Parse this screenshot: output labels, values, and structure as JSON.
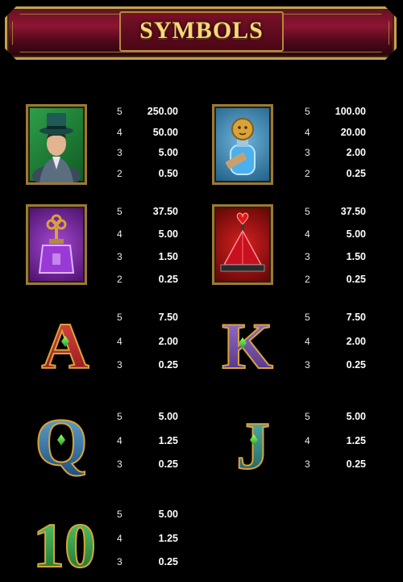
{
  "header": {
    "title": "SYMBOLS"
  },
  "colors": {
    "banner_red": "#8d1532",
    "gold": "#c9a050",
    "title_gold": "#f7d77a",
    "background": "#000000"
  },
  "symbols": [
    {
      "name": "magician",
      "icon": "magician-top-hat-icon",
      "payouts": [
        {
          "count": "5",
          "value": "250.00"
        },
        {
          "count": "4",
          "value": "50.00"
        },
        {
          "count": "3",
          "value": "5.00"
        },
        {
          "count": "2",
          "value": "0.50"
        }
      ]
    },
    {
      "name": "courage-potion",
      "icon": "courage-lion-bottle-icon",
      "payouts": [
        {
          "count": "5",
          "value": "100.00"
        },
        {
          "count": "4",
          "value": "20.00"
        },
        {
          "count": "3",
          "value": "2.00"
        },
        {
          "count": "2",
          "value": "0.25"
        }
      ]
    },
    {
      "name": "purple-perfume",
      "icon": "perfume-bottle-icon",
      "payouts": [
        {
          "count": "5",
          "value": "37.50"
        },
        {
          "count": "4",
          "value": "5.00"
        },
        {
          "count": "3",
          "value": "1.50"
        },
        {
          "count": "2",
          "value": "0.25"
        }
      ]
    },
    {
      "name": "ruby-heart-pyramid",
      "icon": "ruby-pyramid-icon",
      "payouts": [
        {
          "count": "5",
          "value": "37.50"
        },
        {
          "count": "4",
          "value": "5.00"
        },
        {
          "count": "3",
          "value": "1.50"
        },
        {
          "count": "2",
          "value": "0.25"
        }
      ]
    },
    {
      "name": "ace",
      "glyph": "A",
      "payouts": [
        {
          "count": "5",
          "value": "7.50"
        },
        {
          "count": "4",
          "value": "2.00"
        },
        {
          "count": "3",
          "value": "0.25"
        }
      ]
    },
    {
      "name": "king",
      "glyph": "K",
      "payouts": [
        {
          "count": "5",
          "value": "7.50"
        },
        {
          "count": "4",
          "value": "2.00"
        },
        {
          "count": "3",
          "value": "0.25"
        }
      ]
    },
    {
      "name": "queen",
      "glyph": "Q",
      "payouts": [
        {
          "count": "5",
          "value": "5.00"
        },
        {
          "count": "4",
          "value": "1.25"
        },
        {
          "count": "3",
          "value": "0.25"
        }
      ]
    },
    {
      "name": "jack",
      "glyph": "J",
      "payouts": [
        {
          "count": "5",
          "value": "5.00"
        },
        {
          "count": "4",
          "value": "1.25"
        },
        {
          "count": "3",
          "value": "0.25"
        }
      ]
    },
    {
      "name": "ten",
      "glyph": "10",
      "payouts": [
        {
          "count": "5",
          "value": "5.00"
        },
        {
          "count": "4",
          "value": "1.25"
        },
        {
          "count": "3",
          "value": "0.25"
        }
      ]
    }
  ]
}
